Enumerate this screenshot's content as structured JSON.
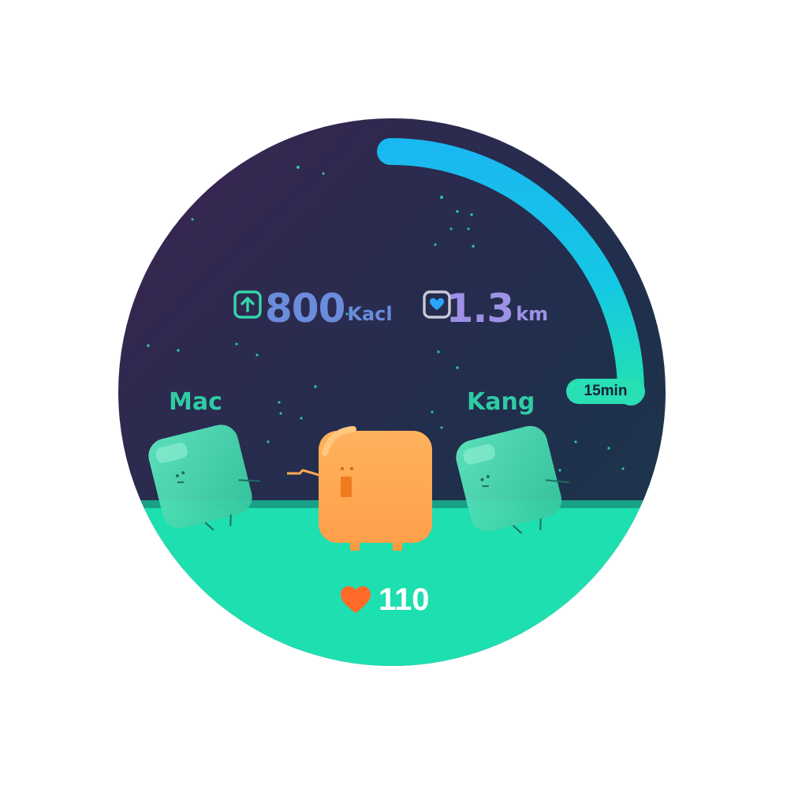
{
  "stats": {
    "calories_icon": "arrow-up-square-icon",
    "calories_value": "800",
    "calories_unit": "Kacl",
    "distance_icon": "heart-square-icon",
    "distance_value": "1.3",
    "distance_unit": "km"
  },
  "timer": {
    "label": "15min",
    "progress": 0.25
  },
  "players": [
    {
      "name": "Mac"
    },
    {
      "name": "Kang"
    }
  ],
  "heart_rate": {
    "icon": "heart-icon",
    "value": "110"
  },
  "colors": {
    "accent_cyan": "#1fc4ee",
    "accent_green": "#29dfb4",
    "ground": "#1edfb0",
    "calories_text": "#6b8cdc",
    "distance_text": "#9d91e6",
    "player_orange": "#ffaa55",
    "heart": "#ff6a28"
  }
}
